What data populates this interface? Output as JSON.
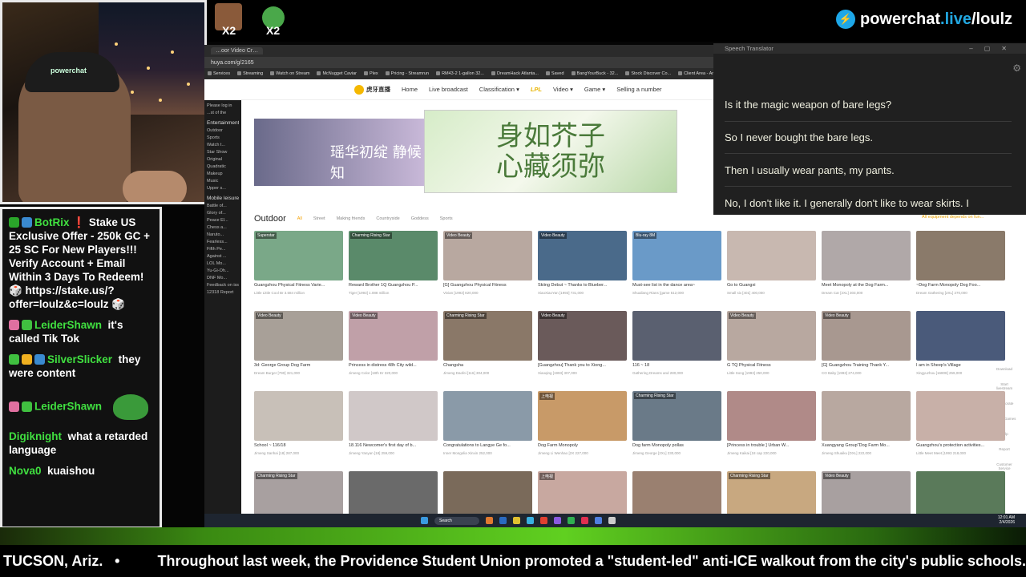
{
  "overlay": {
    "brand_domain": "powerchat",
    "brand_live": ".live",
    "brand_path": "/loulz",
    "emote_counts": [
      "X2",
      "X2"
    ],
    "cam_hat_text": "powerchat"
  },
  "chat": {
    "messages": [
      {
        "user": "BotRix",
        "text": "❗ Stake US Exclusive Offer - 250k GC + 25 SC For New Players!!! Verify Account + Email Within 3 Days To Redeem! 🎲 https://stake.us/?offer=loulz&c=loulz 🎲"
      },
      {
        "user": "LeiderShawn",
        "text": "it's called Tik Tok"
      },
      {
        "user": "SilverSlicker",
        "text": "they were content"
      },
      {
        "user": "LeiderShawn",
        "text": ""
      },
      {
        "user": "Digiknight",
        "text": "what a retarded language"
      },
      {
        "user": "Nova0",
        "text": "kuaishou"
      }
    ]
  },
  "browser": {
    "tab": "…oor Video Cr…",
    "url": "huya.com/g/2165",
    "bookmarks": [
      "Services",
      "Streaming",
      "Watch on Stream",
      "McNugget Caviar",
      "Plex",
      "Pricing - Streamrun",
      "RM43-2 1-gallon 32...",
      "DreamHack Atlanta...",
      "Saved",
      "BangYourBuck - 32...",
      "Stock Discover Co...",
      "Client Area - AntiSc..."
    ],
    "site": {
      "logo": "虎牙直播",
      "nav": [
        "Home",
        "Live broadcast",
        "Classification ▾",
        "LPL",
        "Video ▾",
        "Game ▾",
        "Selling a number"
      ],
      "banner_text": "身如芥子 心藏须弥",
      "banner_left_text": "瑶华初绽 静候知",
      "filters_title": "Outdoor",
      "filters": [
        "All",
        "Street",
        "Making friends",
        "Countryside",
        "Goddess",
        "Sports"
      ]
    },
    "sidebar": [
      "Please log in",
      "...st of the",
      "Entertainment World",
      "Outdoor",
      "Sports",
      "Watch t...",
      "Star Show",
      "Original",
      "Quadratic",
      "Makeup",
      "Music",
      "Upper s...",
      "Mobile leisure",
      "Battle of...",
      "Glory of...",
      "Peace El...",
      "Chess a...",
      "Naruto...",
      "Fearless...",
      "Fifth Pe...",
      "Against ...",
      "LOL Mo...",
      "Yu-Gi-Oh...",
      "DNF Mo...",
      "Feedback on issues",
      "12318 Report"
    ],
    "cards": [
      {
        "tag": "Superstar",
        "title": "Guangzhou Physical Fitness Varie...",
        "meta": "Little Little Cool Br  3.584 million",
        "color": "#7aa888"
      },
      {
        "tag": "Charming Rising Star",
        "title": "Reward Brother 1Q Guangzhou P...",
        "meta": "Tiger [1993]  1.088 million",
        "color": "#5a8a6a"
      },
      {
        "tag": "Video Beauty",
        "title": "[G] Guangzhou Physical Fitness",
        "meta": "Vivian [1993]  820,000",
        "color": "#b8a8a0"
      },
      {
        "tag": "Video Beauty",
        "title": "Skiing Debut ~ Thanks to Blueber...",
        "meta": "XiaoXiaoYan [1993]  731,000",
        "color": "#4a6a8a"
      },
      {
        "tag": "Blu-ray 8M",
        "title": "Must-see list in the dance area~",
        "meta": "Shuailang Rians [game  512,000",
        "color": "#6a9ac8"
      },
      {
        "tag": "",
        "title": "Go to Guangxi",
        "meta": "Small six [401]  400,000",
        "color": "#c8b8b0"
      },
      {
        "tag": "",
        "title": "Meet Monopoly at the Dog Farm...",
        "meta": "Dream Car [2XL]  303,000",
        "color": "#b0a8a8"
      },
      {
        "tag": "",
        "title": "~Dog Farm Monopoly Dog Foo...",
        "meta": "Dream Gathering [2XL]  270,000",
        "color": "#8a7a6a"
      },
      {
        "tag": "Video Beauty",
        "title": "3d: George Group Dog Farm",
        "meta": "Dream Burger [790]  321,000",
        "color": "#a8a098"
      },
      {
        "tag": "Video Beauty",
        "title": "Princess in distress 48h City wild...",
        "meta": "Jimeng Color [18th Er  320,000",
        "color": "#c0a0a8"
      },
      {
        "tag": "Charming Rising Star",
        "title": "Changsha",
        "meta": "Jimeng Daofei [116]  304,000",
        "color": "#8a7868"
      },
      {
        "tag": "Video Beauty",
        "title": "[Guangzhou] Thank you to Xiong...",
        "meta": "Xiaoqing [1993]  307,000",
        "color": "#6a5a5a"
      },
      {
        "tag": "",
        "title": "116 ~ 18",
        "meta": "Gathering Dreams and  280,000",
        "color": "#5a6070"
      },
      {
        "tag": "Video Beauty",
        "title": "G TQ Physical Fitness",
        "meta": "Little Song [1993]  250,000",
        "color": "#b8a8a0"
      },
      {
        "tag": "Video Beauty",
        "title": "[G] Guangzhou Training Thank Y...",
        "meta": "CO Baby [1993]  274,000",
        "color": "#a89890"
      },
      {
        "tag": "",
        "title": "I am in Sheep's Village",
        "meta": "Xingyuzhou [16808]  259,000",
        "color": "#4a5a7a"
      },
      {
        "tag": "",
        "title": "School ~ 116/18",
        "meta": "Jimeng Sanhai [18]  287,000",
        "color": "#c8c0b8"
      },
      {
        "tag": "",
        "title": "18.116 Newcomer's first day of b...",
        "meta": "Jimeng Yanyan [18]  259,000",
        "color": "#d0c8c8"
      },
      {
        "tag": "",
        "title": "Congratulations to Langye Ge fo...",
        "meta": "Inner Mongolia Xinxin  252,000",
        "color": "#8a9aa8"
      },
      {
        "tag": "上电视",
        "title": "Dog Farm Monopoly",
        "meta": "Jimeng Li Wenhao [2X  227,000",
        "color": "#c89a68"
      },
      {
        "tag": "Charming Rising Star",
        "title": "Dog farm Monopoly pollas",
        "meta": "Jimeng George [2XL]  230,000",
        "color": "#6a7a88"
      },
      {
        "tag": "",
        "title": "[Princess in trouble ] Urban W...",
        "meta": "Jimeng Kaikai [18 cap  220,000",
        "color": "#b08a88"
      },
      {
        "tag": "",
        "title": "Xuangyang Group\"Dog Farm Mo...",
        "meta": "Jimeng Shuaiku [DXL]  222,000",
        "color": "#b8a8a0"
      },
      {
        "tag": "",
        "title": "Guangzhou's protection activities...",
        "meta": "Little Meet Meet [1993  218,000",
        "color": "#c8b0a8"
      },
      {
        "tag": "Charming Rising Star",
        "title": "",
        "meta": "",
        "color": "#a8a0a0"
      },
      {
        "tag": "",
        "title": "",
        "meta": "",
        "color": "#6a6a6a"
      },
      {
        "tag": "",
        "title": "",
        "meta": "",
        "color": "#7a6a5a"
      },
      {
        "tag": "上电视",
        "title": "",
        "meta": "",
        "color": "#c8a8a0"
      },
      {
        "tag": "",
        "title": "",
        "meta": "",
        "color": "#9a8070"
      },
      {
        "tag": "Charming Rising Star",
        "title": "",
        "meta": "",
        "color": "#c8a880"
      },
      {
        "tag": "Video Beauty",
        "title": "",
        "meta": "",
        "color": "#a8a0a0"
      },
      {
        "tag": "",
        "title": "",
        "meta": "",
        "color": "#5a7a5a"
      }
    ],
    "side_icons": [
      "Download",
      "Start livestream",
      "Incorporate",
      "Online Games",
      "Help",
      "Report",
      "Customer Service"
    ],
    "equipment_note": "All equipment depends on fun..."
  },
  "translator": {
    "title": "Speech Translator",
    "lines": [
      "Is it the magic weapon of bare legs?",
      "So I never bought the bare legs.",
      "Then I usually wear pants, my pants.",
      "No, I don't like it. I generally don't like to wear skirts. I"
    ]
  },
  "taskbar": {
    "search": "Search",
    "time": "12:01 AM",
    "date": "2/4/2026"
  },
  "ticker": {
    "location": "TUCSON, Ariz.",
    "bullet": "•",
    "headline": "Throughout last week, the Providence Student Union promoted a \"student-led\" anti-ICE walkout from the city's public schools."
  }
}
